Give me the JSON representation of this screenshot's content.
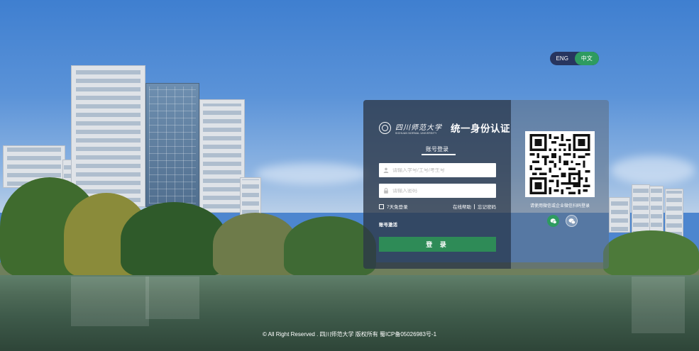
{
  "colors": {
    "accent_green": "#2e8b57",
    "panel_dark": "#2d3848",
    "lang_bg": "#27355f"
  },
  "lang_toggle": {
    "options": [
      "ENG",
      "中文"
    ],
    "selected": "中文"
  },
  "brand": {
    "logo_cn": "四川师范大学",
    "logo_en": "SICHUAN NORMAL UNIVERSITY",
    "title": "统一身份认证"
  },
  "login": {
    "tab_label": "账号登录",
    "username_placeholder": "请输入学号/工号/考生号",
    "password_placeholder": "请输入密码",
    "remember_label": "7天免登录",
    "help_link": "在线帮助",
    "forgot_link": "忘记密码",
    "activate_link": "账号激活",
    "submit_label": "登 录"
  },
  "qr_panel": {
    "caption": "请使用微信或企业微信扫码登录",
    "icons": [
      "wechat-work-icon",
      "wechat-icon"
    ]
  },
  "footer": {
    "text": "© All Right Reserved . 四川师范大学 版权所有 蜀ICP备05026983号-1"
  }
}
